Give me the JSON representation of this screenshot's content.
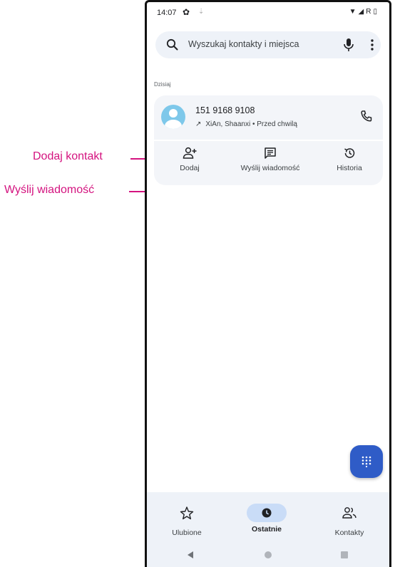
{
  "status_bar": {
    "time": "14:07",
    "right_text": "R"
  },
  "search": {
    "placeholder": "Wyszukaj kontakty i miejsca"
  },
  "section_label": "Dzisiaj",
  "call_entry": {
    "number": "151 9168 9108",
    "detail": "XiAn, Shaanxi • Przed chwilą"
  },
  "actions": {
    "add_label": "Dodaj",
    "message_label": "Wyślij wiadomość",
    "history_label": "Historia"
  },
  "bottom_nav": {
    "favorites_label": "Ulubione",
    "recent_label": "Ostatnie",
    "contacts_label": "Kontakty"
  },
  "callouts": {
    "add_contact": "Dodaj kontakt",
    "send_message": "Wyślij wiadomość"
  },
  "colors": {
    "accent": "#2f5cc7",
    "callout": "#d4137f",
    "nav_bg": "#eef2f8",
    "active_pill": "#c9dcf7",
    "avatar": "#7ec8ea"
  },
  "icons": [
    "settings-icon",
    "download-icon",
    "wifi-icon",
    "signal-icon",
    "battery-icon",
    "search-icon",
    "mic-icon",
    "more-vert-icon",
    "avatar-icon",
    "outgoing-call-icon",
    "phone-icon",
    "add-person-icon",
    "message-icon",
    "history-icon",
    "dialpad-icon",
    "star-icon",
    "clock-icon",
    "contacts-icon",
    "back-icon",
    "home-icon",
    "recents-icon"
  ]
}
